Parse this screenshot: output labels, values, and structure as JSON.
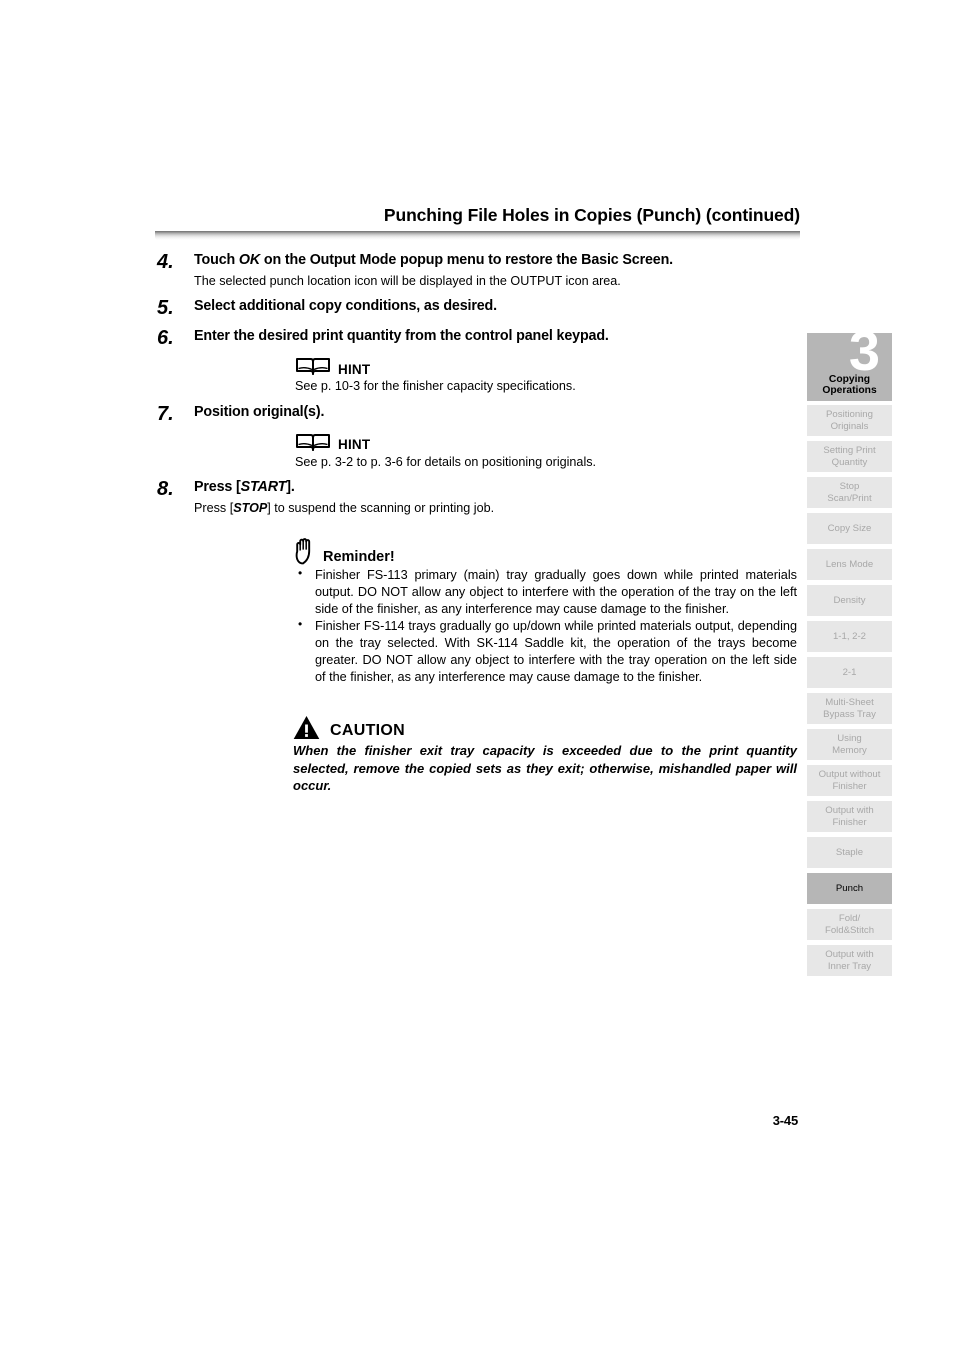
{
  "header": {
    "title": "Punching File Holes in Copies (Punch) (continued)"
  },
  "steps": [
    {
      "number": "4.",
      "title_pre": "Touch ",
      "title_em": "OK",
      "title_post": " on the Output Mode popup menu to restore the Basic Screen.",
      "sub": "The selected punch location icon will be displayed in the OUTPUT icon area."
    },
    {
      "number": "5.",
      "title": "Select additional copy conditions, as desired."
    },
    {
      "number": "6.",
      "title": "Enter the desired print quantity from the control panel keypad."
    },
    {
      "number": "7.",
      "title": "Position original(s)."
    },
    {
      "number": "8.",
      "title_pre": "Press [",
      "title_em": "START",
      "title_post": "].",
      "sub_pre": "Press [",
      "sub_em": "STOP",
      "sub_post": "] to suspend the scanning or printing job."
    }
  ],
  "hints": [
    {
      "label": "HINT",
      "text": "See p. 10-3 for the finisher capacity specifications.",
      "icon": "open-book-icon"
    },
    {
      "label": "HINT",
      "text": "See p. 3-2 to p. 3-6 for details on positioning originals.",
      "icon": "open-book-icon"
    }
  ],
  "reminder": {
    "label": "Reminder",
    "label_suffix": "!",
    "icon": "raised-hand-icon",
    "items": [
      "Finisher FS-113 primary (main) tray gradually goes down while printed materials output. DO NOT allow any object to interfere with the operation of the tray on the left side of the finisher, as any interference may cause damage to the finisher.",
      "Finisher FS-114 trays gradually go up/down while printed materials output, depending on the tray selected. With SK-114 Saddle kit, the operation of the trays become greater. DO NOT allow any object to interfere with the tray operation on the left side of the finisher, as any interference may cause damage to the finisher."
    ]
  },
  "caution": {
    "label": "CAUTION",
    "icon": "warning-triangle-icon",
    "text": "When the finisher exit tray capacity is exceeded due to the print quantity selected, remove the copied sets as they exit; otherwise, mishandled paper will occur."
  },
  "sidebar": {
    "chapter_number": "3",
    "chapter_name_line1": "Copying",
    "chapter_name_line2": "Operations",
    "active_tab": "Punch",
    "items": [
      {
        "line1": "Positioning",
        "line2": "Originals",
        "active": false
      },
      {
        "line1": "Setting Print",
        "line2": "Quantity",
        "active": false
      },
      {
        "line1": "Stop",
        "line2": "Scan/Print",
        "active": false
      },
      {
        "line1": "Copy Size",
        "line2": "",
        "active": false
      },
      {
        "line1": "Lens Mode",
        "line2": "",
        "active": false
      },
      {
        "line1": "Density",
        "line2": "",
        "active": false
      },
      {
        "line1": "1-1, 2-2",
        "line2": "",
        "active": false
      },
      {
        "line1": "2-1",
        "line2": "",
        "active": false
      },
      {
        "line1": "Multi-Sheet",
        "line2": "Bypass Tray",
        "active": false
      },
      {
        "line1": "Using",
        "line2": "Memory",
        "active": false
      },
      {
        "line1": "Output without",
        "line2": "Finisher",
        "active": false
      },
      {
        "line1": "Output with",
        "line2": "Finisher",
        "active": false
      },
      {
        "line1": "Staple",
        "line2": "",
        "active": false
      },
      {
        "line1": "Punch",
        "line2": "",
        "active": true
      },
      {
        "line1": "Fold/",
        "line2": "Fold&Stitch",
        "active": false
      },
      {
        "line1": "Output with",
        "line2": "Inner Tray",
        "active": false
      }
    ]
  },
  "footer": {
    "page_number": "3-45"
  },
  "colors": {
    "tab_inactive_bg": "#e7e7e7",
    "tab_inactive_text": "#a8a8a8",
    "tab_active_bg": "#b6b6b6",
    "tab_active_text": "#000000",
    "chapter_bg": "#b6b6b6",
    "text": "#000000"
  }
}
